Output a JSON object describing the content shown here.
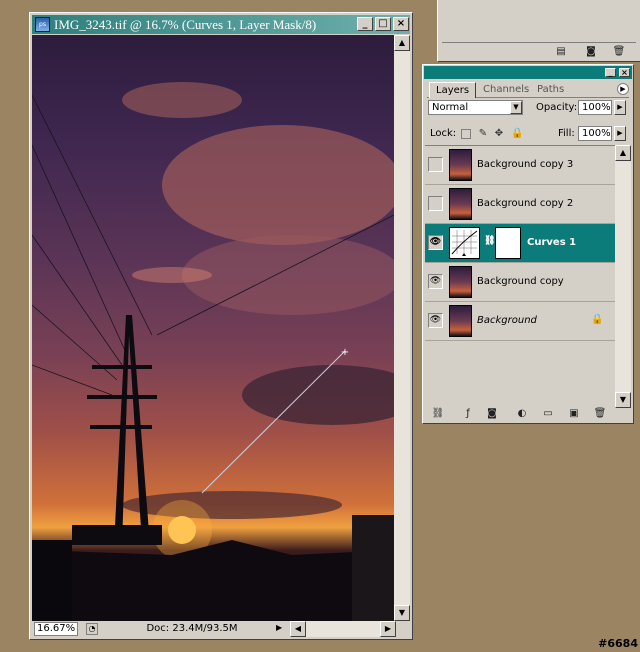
{
  "document": {
    "title": "IMG_3243.tif @ 16.7% (Curves 1, Layer Mask/8)",
    "app_icon_text": "ps",
    "zoom": "16.67%",
    "doc_info": "Doc: 23.4M/93.5M"
  },
  "palette": {
    "tabs": [
      {
        "label": "Layers",
        "active": true
      },
      {
        "label": "Channels",
        "active": false
      },
      {
        "label": "Paths",
        "active": false
      }
    ],
    "blend_mode": "Normal",
    "opacity_label": "Opacity:",
    "opacity_value": "100%",
    "lock_label": "Lock:",
    "fill_label": "Fill:",
    "fill_value": "100%",
    "layers": [
      {
        "name": "Background copy 3",
        "visible": false,
        "selected": false,
        "italic": false
      },
      {
        "name": "Background copy 2",
        "visible": false,
        "selected": false,
        "italic": false
      },
      {
        "name": "Curves 1",
        "visible": true,
        "selected": true,
        "italic": false,
        "adjustment": true
      },
      {
        "name": "Background copy",
        "visible": true,
        "selected": false,
        "italic": false
      },
      {
        "name": "Background",
        "visible": true,
        "selected": false,
        "italic": true,
        "locked": true
      }
    ]
  },
  "watermark": "#6684",
  "colors": {
    "desktop": "#9a8462",
    "title_teal": "#0c7c7a",
    "selected_layer": "#0c7c7a"
  }
}
